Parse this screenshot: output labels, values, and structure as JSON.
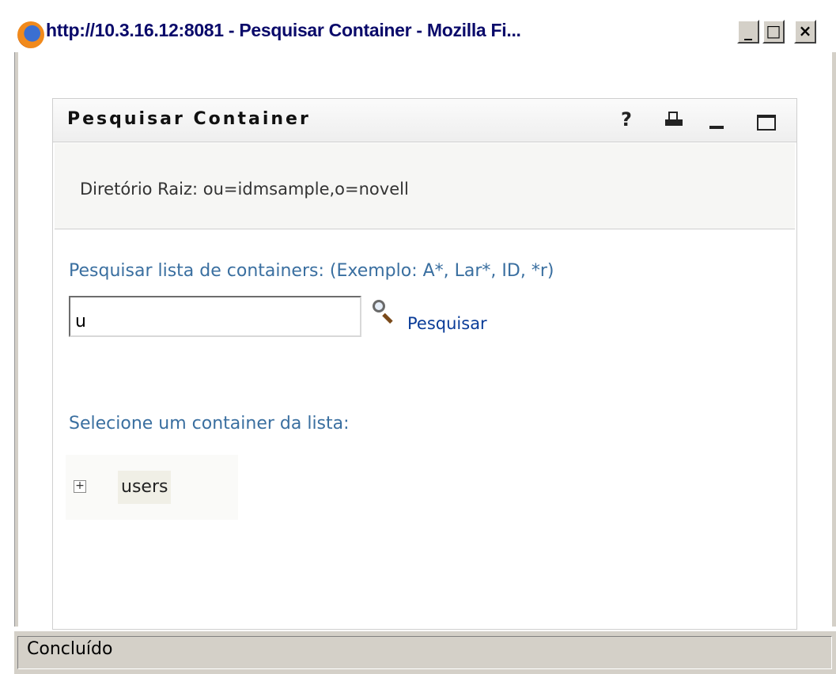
{
  "window": {
    "title": "http://10.3.16.12:8081 - Pesquisar Container - Mozilla Fi...",
    "buttons": {
      "minimize": "_",
      "maximize": "□",
      "close": "×"
    }
  },
  "portlet": {
    "title": "Pesquisar Container",
    "help_icon": "?",
    "root_directory_text": "Diretório Raiz: ou=idmsample,o=novell",
    "search_label": "Pesquisar lista de containers: (Exemplo: A*, Lar*, ID, *r)",
    "search_value": "u",
    "search_link": "Pesquisar",
    "select_label": "Selecione um container da lista:",
    "tree_items": [
      {
        "label": "users",
        "expander": "+"
      }
    ]
  },
  "statusbar": {
    "text": "Concluído"
  },
  "colors": {
    "label_blue": "#3a6fa0",
    "link_blue": "#0a3c98",
    "title_blue": "#0a0a6a"
  }
}
